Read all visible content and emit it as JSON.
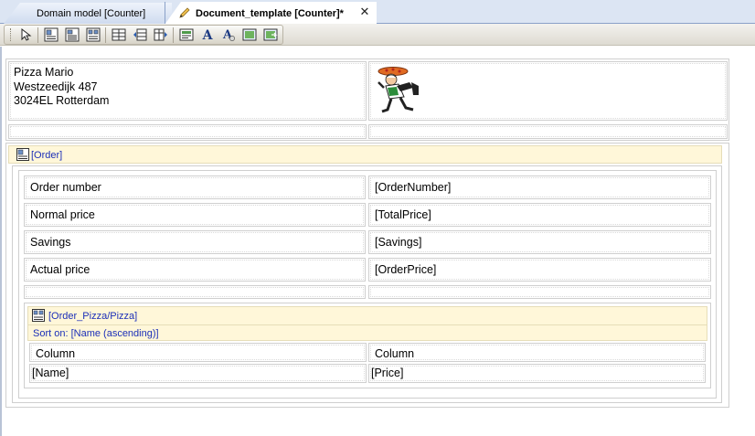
{
  "tabs": [
    {
      "label": "Domain model [Counter]",
      "active": false
    },
    {
      "label": "Document_template [Counter]*",
      "active": true
    }
  ],
  "toolbar": {
    "buttons": [
      "select-pointer-icon",
      "data-view-icon",
      "data-grid-icon",
      "template-grid-icon",
      "table-icon",
      "table-row-icon",
      "table-cell-icon",
      "dynamic-label-icon",
      "static-label-icon",
      "styled-label-icon",
      "static-image-icon",
      "dynamic-image-icon"
    ]
  },
  "header": {
    "address_lines": [
      "Pizza Mario",
      "Westzeedijk 487",
      "3024EL Rotterdam"
    ],
    "logo": "pizza-chef-image"
  },
  "order_view": {
    "entity": "[Order]",
    "rows": [
      {
        "label": "Order number",
        "value": "[OrderNumber]"
      },
      {
        "label": "Normal price",
        "value": "[TotalPrice]"
      },
      {
        "label": "Savings",
        "value": "[Savings]"
      },
      {
        "label": "Actual price",
        "value": "[OrderPrice]"
      }
    ],
    "pizza_grid": {
      "entity": "[Order_Pizza/Pizza]",
      "sort": "Sort on: [Name (ascending)]",
      "columns": [
        "Column",
        "Column"
      ],
      "cells": [
        "[Name]",
        "[Price]"
      ]
    }
  },
  "colors": {
    "datasource_header": "#fff7d9",
    "datasource_text": "#1b2fb8",
    "tabstrip": "#dce5f3"
  }
}
